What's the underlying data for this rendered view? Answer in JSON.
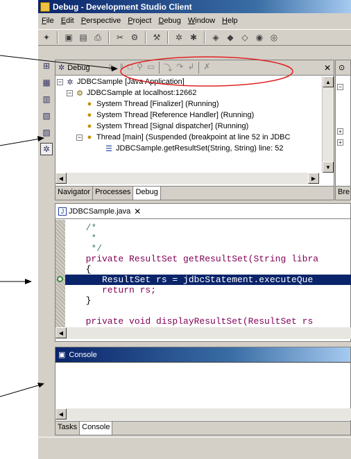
{
  "window": {
    "title": "Debug - Development Studio Client"
  },
  "menu": [
    "File",
    "Edit",
    "Perspective",
    "Project",
    "Debug",
    "Window",
    "Help"
  ],
  "debug_view": {
    "title": "Debug",
    "tree": [
      {
        "indent": 0,
        "icon": "app-icon",
        "text": "JDBCSample [Java Application]"
      },
      {
        "indent": 1,
        "icon": "target-icon",
        "text": "JDBCSample at localhost:12662"
      },
      {
        "indent": 2,
        "icon": "thread-icon",
        "text": "System Thread [Finalizer] (Running)"
      },
      {
        "indent": 2,
        "icon": "thread-icon",
        "text": "System Thread [Reference Handler] (Running)"
      },
      {
        "indent": 2,
        "icon": "thread-icon",
        "text": "System Thread [Signal dispatcher] (Running)"
      },
      {
        "indent": 2,
        "icon": "suspended-thread-icon",
        "text": "Thread [main] (Suspended (breakpoint at line 52 in JDBC"
      },
      {
        "indent": 3,
        "icon": "stack-frame-icon",
        "text": "JDBCSample.getResultSet(String, String) line: 52"
      }
    ],
    "tabs": [
      "Navigator",
      "Processes",
      "Debug"
    ]
  },
  "right_panel": {
    "tab_label": "Bre"
  },
  "editor": {
    "file": "JDBCSample.java",
    "lines": [
      {
        "text": "  /*",
        "cls": "cm"
      },
      {
        "text": "   *",
        "cls": "cm"
      },
      {
        "text": "   */",
        "cls": "cm"
      },
      {
        "text": "  private ResultSet getResultSet(String libra",
        "cls": ""
      },
      {
        "text": "  {",
        "cls": ""
      },
      {
        "text": "     ResultSet rs = jdbcStatement.executeQue",
        "cls": "hl"
      },
      {
        "text": "     return rs;",
        "cls": ""
      },
      {
        "text": "  }",
        "cls": ""
      },
      {
        "text": "",
        "cls": ""
      },
      {
        "text": "  private void displayResultSet(ResultSet rs",
        "cls": ""
      }
    ]
  },
  "console": {
    "title": "Console",
    "tabs": [
      "Tasks",
      "Console"
    ]
  },
  "colors": {
    "annotation_red": "#e02020",
    "selection": "#0a246a"
  }
}
